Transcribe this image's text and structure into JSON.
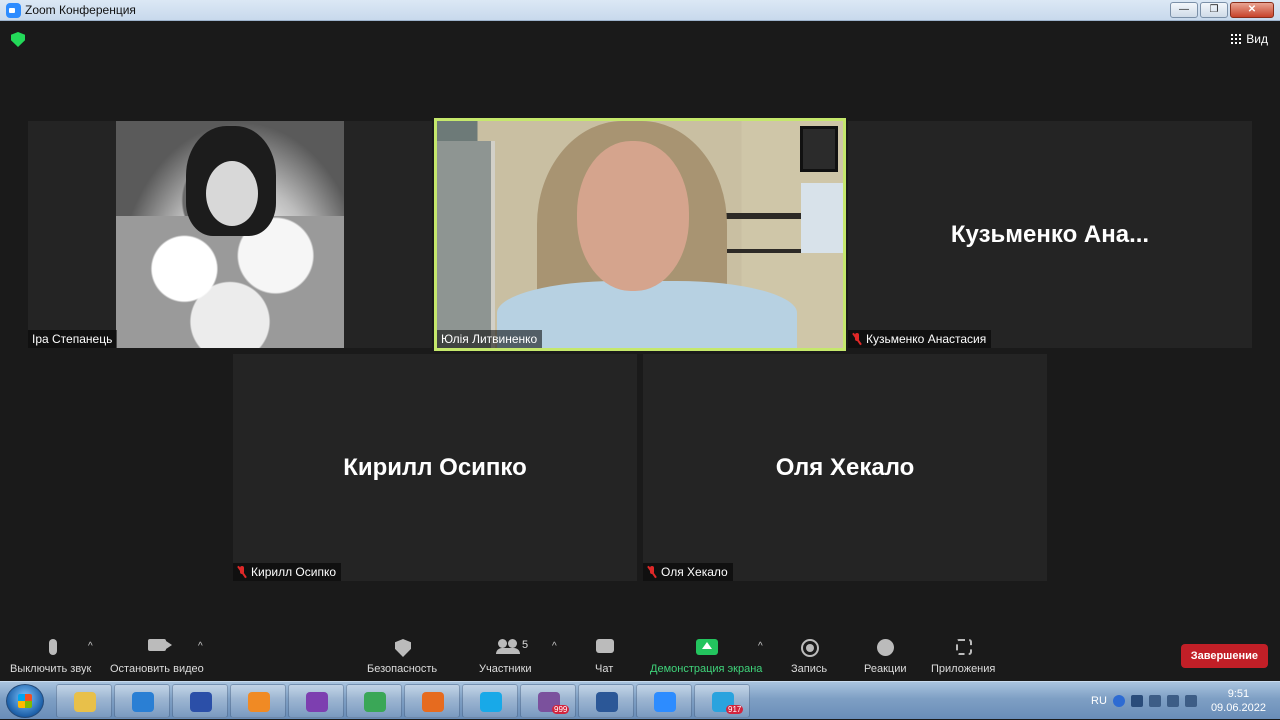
{
  "window": {
    "title": "Zoom Конференция",
    "buttons": [
      "—",
      "❐",
      "✕"
    ]
  },
  "meeting": {
    "view_label": "Вид",
    "tiles": [
      {
        "id": "ira",
        "name": "Іра Степанець",
        "muted": false,
        "display": "photo"
      },
      {
        "id": "yulia",
        "name": "Юлія Литвиненко",
        "muted": false,
        "display": "video",
        "active": true
      },
      {
        "id": "kuzmenko",
        "name": "Кузьменко Анастасия",
        "big_name": "Кузьменко  Ана...",
        "muted": true
      },
      {
        "id": "kirill",
        "name": "Кирилл Осипко",
        "big_name": "Кирилл Осипко",
        "muted": true
      },
      {
        "id": "olya",
        "name": "Оля Хекало",
        "big_name": "Оля Хекало",
        "muted": true
      }
    ]
  },
  "toolbar": {
    "mute_label": "Выключить звук",
    "video_label": "Остановить видео",
    "security_label": "Безопасность",
    "participants_label": "Участники",
    "participants_count": "5",
    "chat_label": "Чат",
    "share_label": "Демонстрация экрана",
    "record_label": "Запись",
    "reactions_label": "Реакции",
    "apps_label": "Приложения",
    "end_label": "Завершение",
    "caret": "^"
  },
  "taskbar": {
    "items": [
      {
        "name": "file-explorer",
        "color": "#e8c04a"
      },
      {
        "name": "internet-explorer",
        "color": "#2a7fd4"
      },
      {
        "name": "save-app",
        "color": "#2b4fa8"
      },
      {
        "name": "media-player",
        "color": "#f08a24"
      },
      {
        "name": "onenote",
        "color": "#7d3fb0"
      },
      {
        "name": "chrome",
        "color": "#3aa757"
      },
      {
        "name": "firefox",
        "color": "#e66b1f"
      },
      {
        "name": "skype",
        "color": "#18a9e8"
      },
      {
        "name": "viber",
        "color": "#7b519d",
        "badge": "999"
      },
      {
        "name": "word",
        "color": "#2b5797"
      },
      {
        "name": "zoom",
        "color": "#2d8cff"
      },
      {
        "name": "telegram",
        "color": "#2aa3de",
        "badge": "917"
      }
    ],
    "language": "RU",
    "time": "9:51",
    "date": "09.06.2022"
  },
  "colors": {
    "active_border": "#c5e86c",
    "end_button": "#c21f27",
    "share_icon": "#23c45e",
    "muted_mic": "#e02828"
  }
}
